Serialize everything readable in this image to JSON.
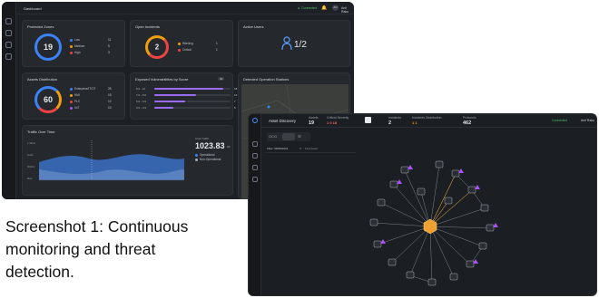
{
  "caption": {
    "lead": "Screenshot 1:",
    "line1_rest": " Continuous",
    "line2": "monitoring and threat",
    "line3": "detection."
  },
  "dashboard": {
    "title": "Dashboard",
    "status": "Connected",
    "avatar": "AN",
    "user": "Anil Raku",
    "cards": {
      "protected": {
        "title": "Protected Zones",
        "value": "19",
        "legend": [
          {
            "label": "Low",
            "value": "11",
            "color": "#3b82f6"
          },
          {
            "label": "Medium",
            "value": "5",
            "color": "#f59e0b"
          },
          {
            "label": "High",
            "value": "3",
            "color": "#ef4444"
          }
        ]
      },
      "incidents": {
        "title": "Open Incidents",
        "value": "2",
        "legend": [
          {
            "label": "Warning",
            "value": "1",
            "color": "#f59e0b"
          },
          {
            "label": "Critical",
            "value": "1",
            "color": "#ef4444"
          }
        ]
      },
      "users": {
        "title": "Active Users",
        "value": "1/2"
      },
      "assets": {
        "title": "Assets Distribution",
        "value": "60",
        "legend": [
          {
            "label": "Enterprise/IT/OT",
            "value": "25",
            "color": "#3b82f6"
          },
          {
            "label": "HMI",
            "value": "15",
            "color": "#f59e0b"
          },
          {
            "label": "PLC",
            "value": "10",
            "color": "#ef4444"
          },
          {
            "label": "IIoT",
            "value": "10",
            "color": "#a855f7"
          }
        ]
      },
      "vulns": {
        "title": "Exposed Vulnerabilities by Score",
        "badge": "40",
        "rows": [
          {
            "label": "8.0 - 10",
            "value": "18",
            "fill": 0.9
          },
          {
            "label": "7.0 - 8.0",
            "value": "10",
            "fill": 0.55
          },
          {
            "label": "5.0 - 6.9",
            "value": "7",
            "fill": 0.4
          },
          {
            "label": "0.0 - 4.9",
            "value": "5",
            "fill": 0.25
          }
        ]
      },
      "stations": {
        "title": "Detected Operation Stations"
      },
      "traffic": {
        "title": "Traffic Over Time",
        "total_label": "Total Traffic",
        "total_value": "1023.83",
        "total_unit": "kB",
        "legend": [
          {
            "label": "Operational",
            "color": "#3b82f6"
          },
          {
            "label": "Non-Operational",
            "color": "#a0aec0"
          }
        ],
        "y_ticks": [
          "1.5kb/s",
          "1kb/s",
          "500b/s",
          "0b/s"
        ]
      }
    }
  },
  "discovery": {
    "title": "Asset Discovery",
    "stats": [
      {
        "label": "Assets",
        "value": "19"
      },
      {
        "label": "Critical Severity",
        "value": "1  0  18"
      },
      {
        "label": "Incidents",
        "value": "2"
      },
      {
        "label": "Incidents Distribution",
        "value": "1  1"
      },
      {
        "label": "Protocols",
        "value": "462"
      }
    ],
    "filter_label": "Filter: 08/08/2024",
    "search_placeholder": "Find Asset",
    "status": "Connected",
    "user": "Anil Raku"
  },
  "colors": {
    "accent_blue": "#3b82f6",
    "accent_orange": "#f59e0b",
    "accent_red": "#ef4444",
    "accent_purple": "#a855f7",
    "hub": "#f0a030"
  }
}
